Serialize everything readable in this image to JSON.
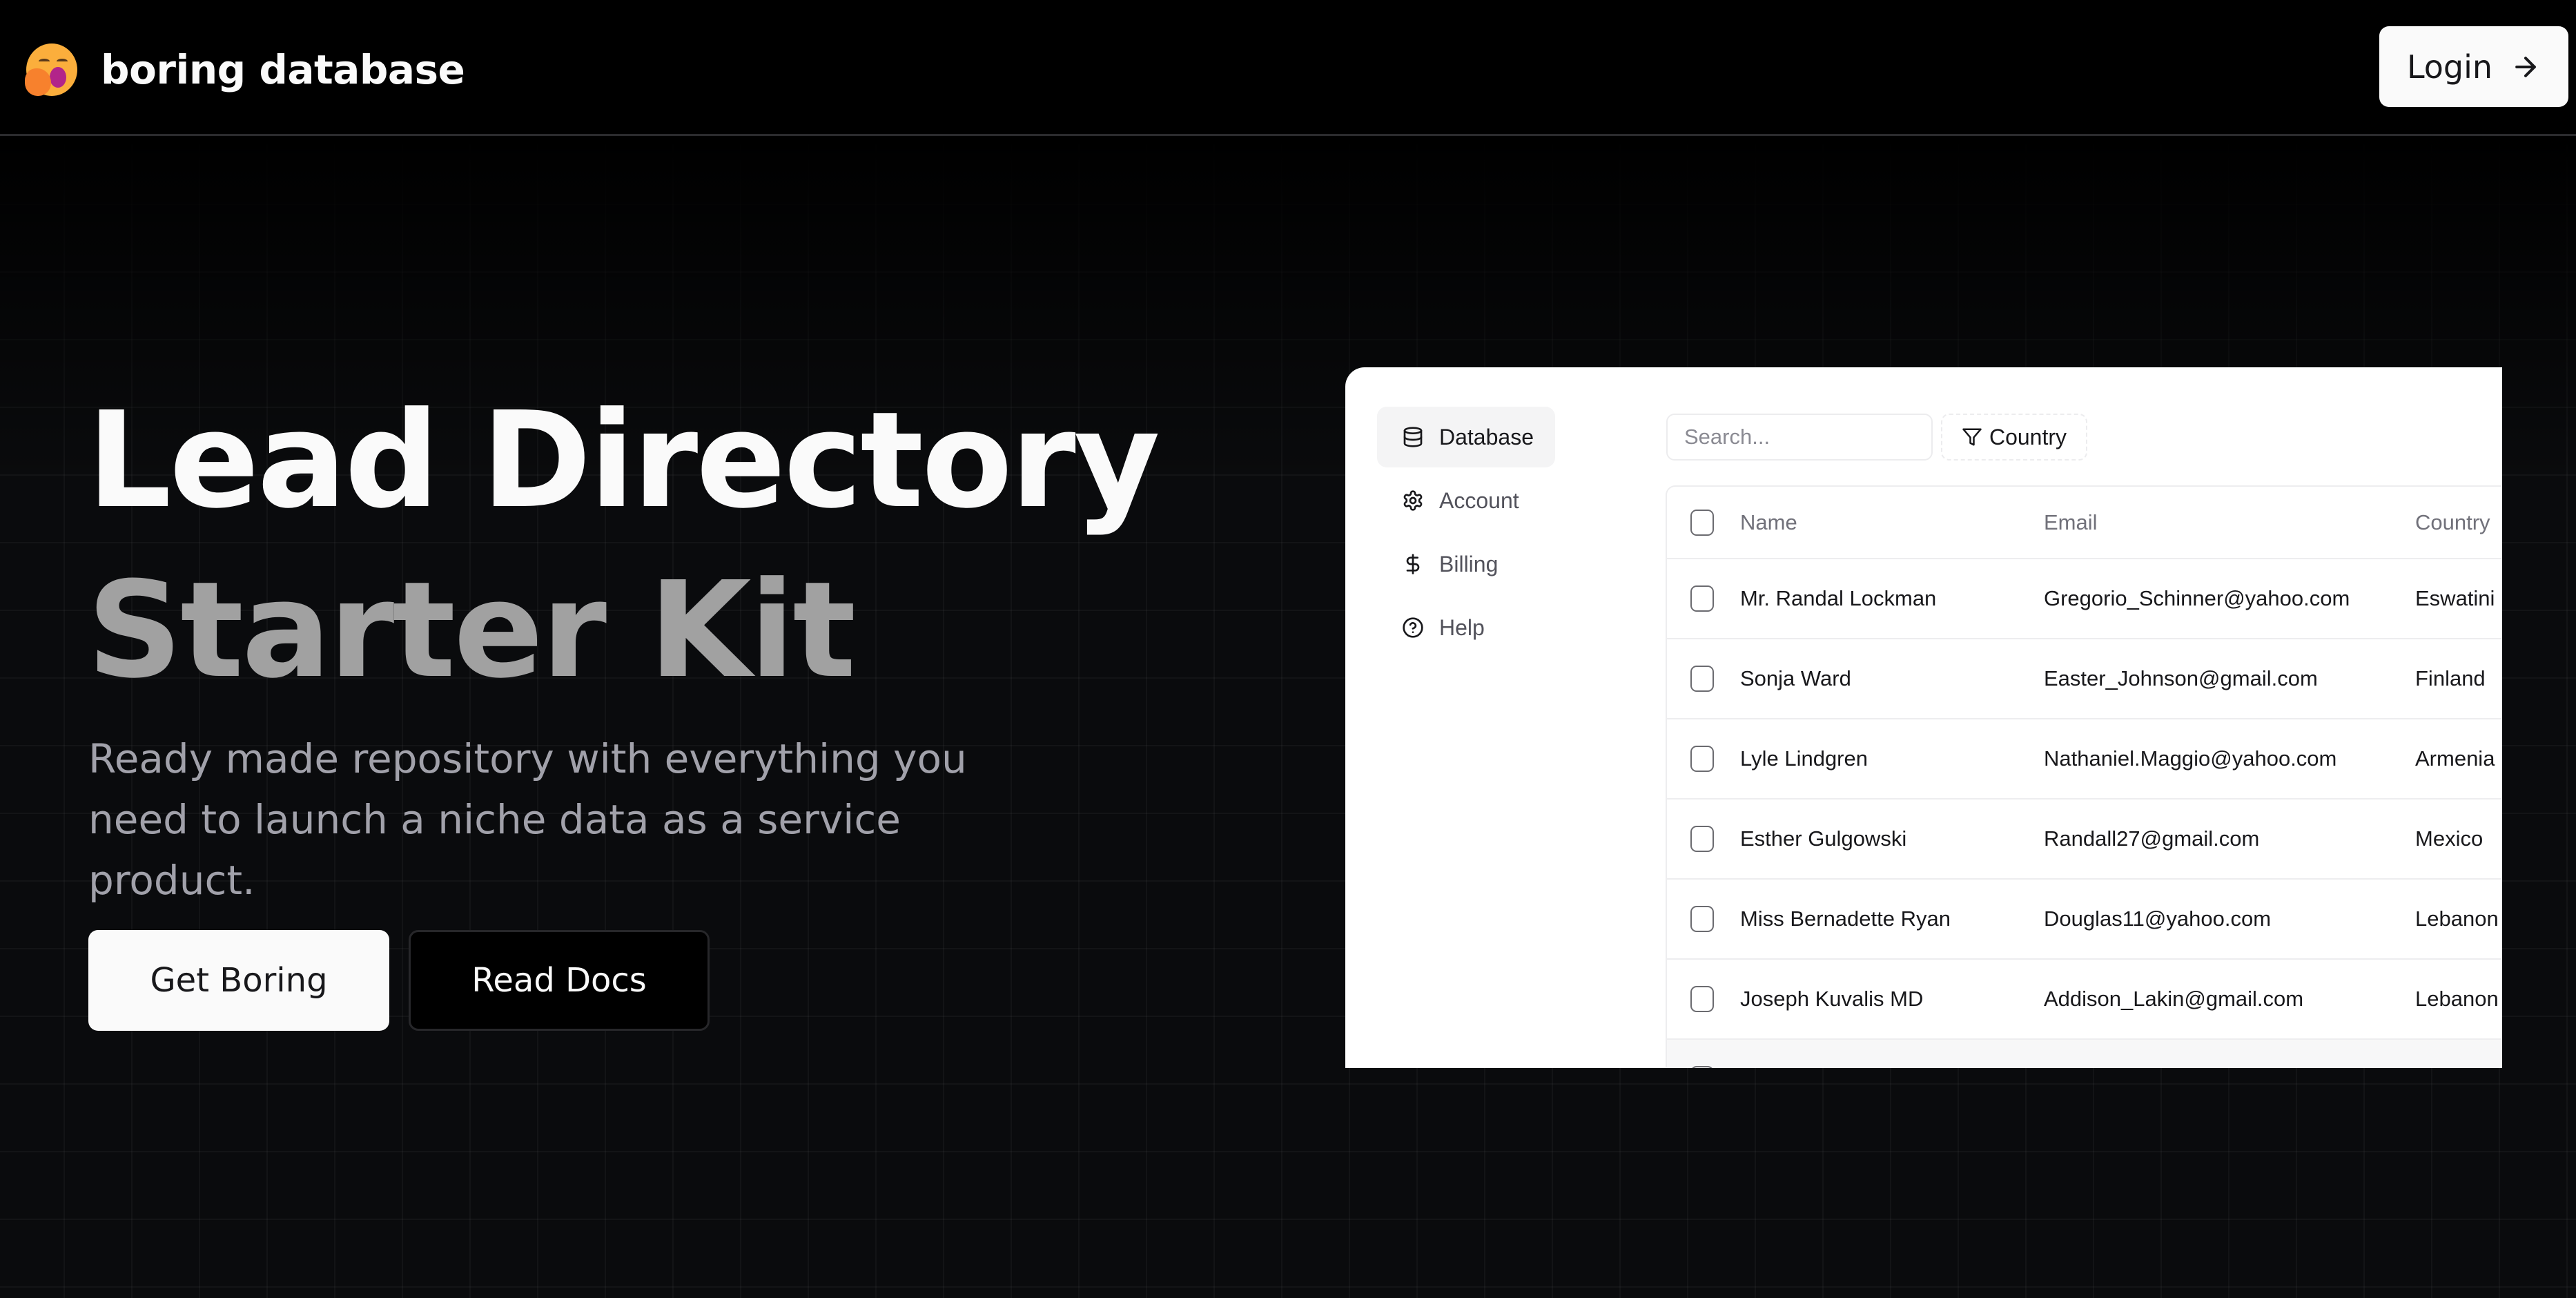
{
  "header": {
    "logo_icon": "yawning-face-emoji",
    "logo_text": "boring database",
    "login_label": "Login",
    "login_icon": "arrow-right-icon"
  },
  "hero": {
    "title_line1": "Lead Directory",
    "title_line2": "Starter Kit",
    "subtitle": "Ready made repository with everything you need to launch a niche data as a service product.",
    "primary_button": "Get Boring",
    "secondary_button": "Read Docs"
  },
  "preview": {
    "sidebar": {
      "items": [
        {
          "label": "Database",
          "icon": "database-icon",
          "active": true
        },
        {
          "label": "Account",
          "icon": "gear-icon",
          "active": false
        },
        {
          "label": "Billing",
          "icon": "dollar-icon",
          "active": false
        },
        {
          "label": "Help",
          "icon": "help-circle-icon",
          "active": false
        }
      ]
    },
    "search": {
      "placeholder": "Search...",
      "value": ""
    },
    "filter": {
      "label": "Country",
      "icon": "filter-icon"
    },
    "table": {
      "columns": [
        "Name",
        "Email",
        "Country"
      ],
      "rows": [
        {
          "name": "Mr. Randal Lockman",
          "email": "Gregorio_Schinner@yahoo.com",
          "country": "Eswatini"
        },
        {
          "name": "Sonja Ward",
          "email": "Easter_Johnson@gmail.com",
          "country": "Finland"
        },
        {
          "name": "Lyle Lindgren",
          "email": "Nathaniel.Maggio@yahoo.com",
          "country": "Armenia"
        },
        {
          "name": "Esther Gulgowski",
          "email": "Randall27@gmail.com",
          "country": "Mexico"
        },
        {
          "name": "Miss Bernadette Ryan",
          "email": "Douglas11@yahoo.com",
          "country": "Lebanon"
        },
        {
          "name": "Joseph Kuvalis MD",
          "email": "Addison_Lakin@gmail.com",
          "country": "Lebanon"
        }
      ]
    }
  },
  "colors": {
    "background": "#0a0b0d",
    "header_bg": "#000000",
    "text_primary": "#fafafa",
    "text_muted": "#a1a1aa",
    "accent_button_bg": "#fafafa"
  }
}
